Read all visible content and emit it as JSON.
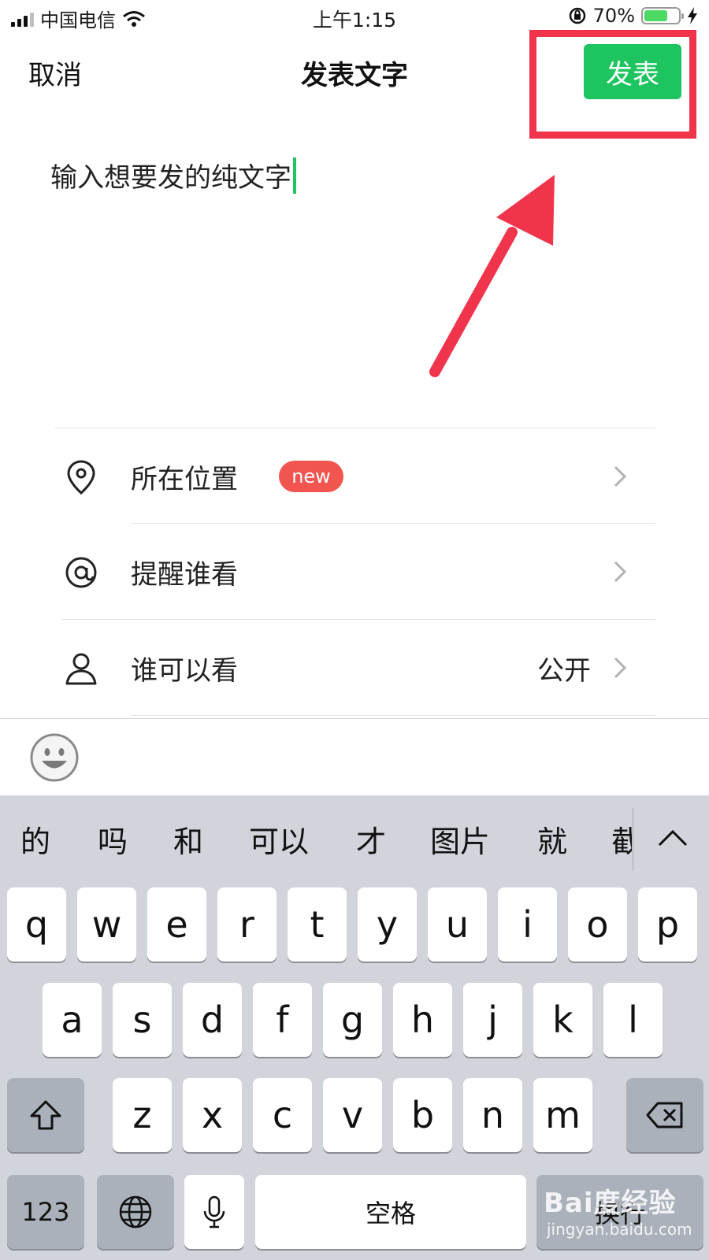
{
  "status_bar": {
    "carrier": "中国电信",
    "time": "上午1:15",
    "battery_percent": "70%",
    "battery_level": 0.7,
    "battery_color": "#4cd964"
  },
  "nav": {
    "cancel_label": "取消",
    "title": "发表文字",
    "publish_label": "发表",
    "accent_color": "#1ec45f"
  },
  "composer": {
    "text": "输入想要发的纯文字"
  },
  "options": [
    {
      "icon": "location-pin-icon",
      "label": "所在位置",
      "badge": "new",
      "value": ""
    },
    {
      "icon": "at-sign-icon",
      "label": "提醒谁看",
      "value": ""
    },
    {
      "icon": "person-icon",
      "label": "谁可以看",
      "value": "公开"
    }
  ],
  "emoji_bar": {
    "icon": "emoji-face-icon"
  },
  "keyboard": {
    "candidates": [
      "的",
      "吗",
      "和",
      "可以",
      "才",
      "图片",
      "就",
      "截"
    ],
    "row1": [
      "q",
      "w",
      "e",
      "r",
      "t",
      "y",
      "u",
      "i",
      "o",
      "p"
    ],
    "row2": [
      "a",
      "s",
      "d",
      "f",
      "g",
      "h",
      "j",
      "k",
      "l"
    ],
    "row3": [
      "z",
      "x",
      "c",
      "v",
      "b",
      "n",
      "m"
    ],
    "numbers_label": "123",
    "space_label": "空格",
    "return_label": "换行"
  },
  "watermark": {
    "brand": "Bai度经验",
    "url": "jingyan.baidu.com"
  },
  "annotation_color": "#f0344c"
}
